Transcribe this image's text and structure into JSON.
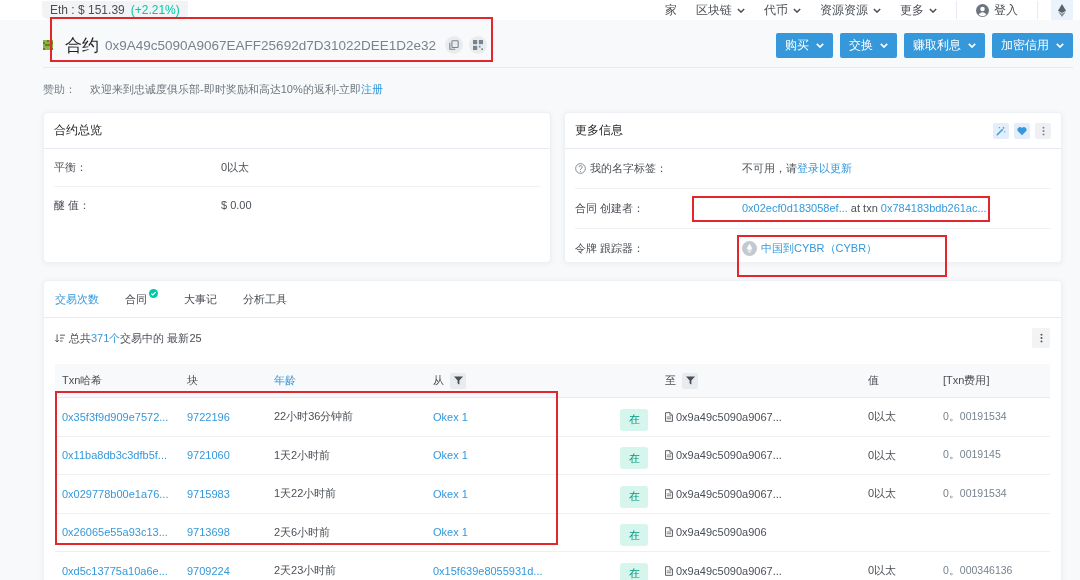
{
  "topbar": {
    "price": "Eth : $ 151.39",
    "change": "(+2.21%)",
    "nav": [
      {
        "label": "家",
        "dropdown": false
      },
      {
        "label": "区块链",
        "dropdown": true
      },
      {
        "label": "代币",
        "dropdown": true
      },
      {
        "label": "资源资源",
        "dropdown": true
      },
      {
        "label": "更多",
        "dropdown": true
      }
    ],
    "login": "登入"
  },
  "header": {
    "label": "合约",
    "address": "0x9A49c5090A9067EAFF25692d7D31022DEE1D2e32",
    "highlighted": true,
    "actions": [
      "购买",
      "交换",
      "赚取利息",
      "加密信用"
    ]
  },
  "sponsor": {
    "label": "赞助：",
    "text": "欢迎来到忠诚度俱乐部-即时奖励和高达10%的返利-立即",
    "link": "注册"
  },
  "overview": {
    "title": "合约总览",
    "rows": [
      {
        "label": "平衡：",
        "value": "0以太"
      },
      {
        "label": "醚 值：",
        "value": "$ 0.00"
      }
    ]
  },
  "more_info": {
    "title": "更多信息",
    "rows": [
      {
        "kind": "name_tag",
        "label": "我的名字标签：",
        "text": "不可用，请",
        "link": "登录以更新",
        "highlighted": false
      },
      {
        "kind": "creator",
        "label": "合同 创建者：",
        "creator": "0x02ecf0d183058ef...",
        "text": "at txn",
        "txn": "0x784183bdb261ac...",
        "highlighted": true
      },
      {
        "kind": "token",
        "label": "令牌 跟踪器：",
        "link": "中国到CYBR（CYBR）",
        "highlighted": true
      }
    ]
  },
  "tabs": [
    {
      "label": "交易次数",
      "selected": true,
      "verified": false
    },
    {
      "label": "合同",
      "selected": false,
      "verified": true
    },
    {
      "label": "大事记",
      "selected": false,
      "verified": false
    },
    {
      "label": "分析工具",
      "selected": false,
      "verified": false
    }
  ],
  "summary": {
    "prefix": "总共",
    "count": "371个",
    "suffix": "交易中的 最新25"
  },
  "table": {
    "columns": [
      {
        "label": "Txn哈希",
        "filter": false,
        "link": false
      },
      {
        "label": "块",
        "filter": false,
        "link": false
      },
      {
        "label": "年龄",
        "filter": false,
        "link": true
      },
      {
        "label": "从",
        "filter": true,
        "link": false
      },
      {
        "label": "至",
        "filter": true,
        "link": false
      },
      {
        "label": "值",
        "filter": false,
        "link": false
      },
      {
        "label": "[Txn费用]",
        "filter": false,
        "link": false
      }
    ],
    "rows": [
      {
        "hash": "0x35f3f9d909e7572...",
        "block": "9722196",
        "age": "22小时36分钟前",
        "from": "Okex 1",
        "direction": "在",
        "to": "0x9a49c5090a9067...",
        "value": "0以太",
        "fee": "0。00191534",
        "highlighted": true
      },
      {
        "hash": "0x11ba8db3c3dfb5f...",
        "block": "9721060",
        "age": "1天2小时前",
        "from": "Okex 1",
        "direction": "在",
        "to": "0x9a49c5090a9067...",
        "value": "0以太",
        "fee": "0。0019145",
        "highlighted": true
      },
      {
        "hash": "0x029778b00e1a76...",
        "block": "9715983",
        "age": "1天22小时前",
        "from": "Okex 1",
        "direction": "在",
        "to": "0x9a49c5090a9067...",
        "value": "0以太",
        "fee": "0。00191534",
        "highlighted": true
      },
      {
        "hash": "0x26065e55a93c13...",
        "block": "9713698",
        "age": "2天6小时前",
        "from": "Okex 1",
        "direction": "在",
        "to": "0x9a49c5090a906",
        "highlighted": true
      },
      {
        "hash": "0xd5c13775a10a6e...",
        "block": "9709224",
        "age": "2天23小时前",
        "from": "0x15f639e8055931d...",
        "direction": "在",
        "to": "0x9a49c5090a9067...",
        "value": "0以太",
        "fee": "0。000346136",
        "highlighted": false
      }
    ]
  }
}
